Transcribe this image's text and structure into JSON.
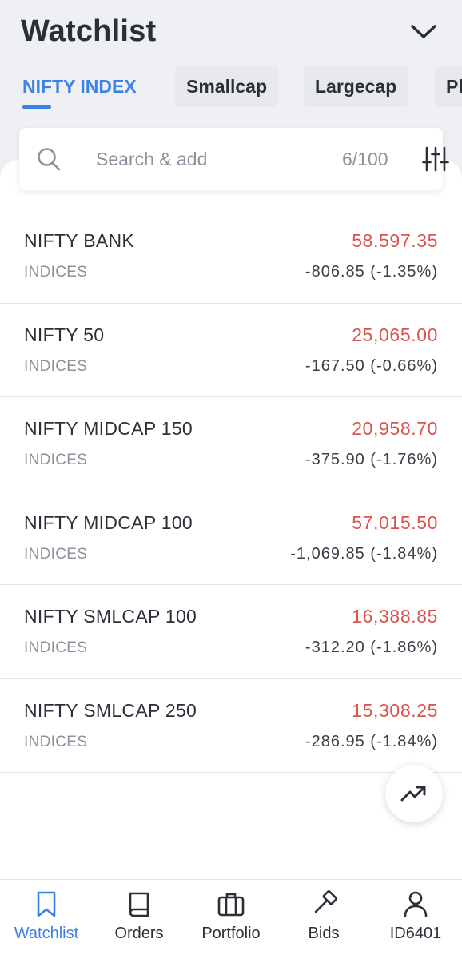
{
  "header": {
    "title": "Watchlist",
    "tabs": [
      {
        "label": "NIFTY INDEX",
        "active": true
      },
      {
        "label": "Smallcap",
        "active": false
      },
      {
        "label": "Largecap",
        "active": false
      },
      {
        "label": "Pl",
        "active": false
      }
    ]
  },
  "search": {
    "placeholder": "Search & add",
    "count": "6/100"
  },
  "rows": [
    {
      "name": "NIFTY BANK",
      "segment": "INDICES",
      "ltp": "58,597.35",
      "change": "-806.85 (-1.35%)"
    },
    {
      "name": "NIFTY 50",
      "segment": "INDICES",
      "ltp": "25,065.00",
      "change": "-167.50 (-0.66%)"
    },
    {
      "name": "NIFTY MIDCAP 150",
      "segment": "INDICES",
      "ltp": "20,958.70",
      "change": "-375.90 (-1.76%)"
    },
    {
      "name": "NIFTY MIDCAP 100",
      "segment": "INDICES",
      "ltp": "57,015.50",
      "change": "-1,069.85 (-1.84%)"
    },
    {
      "name": "NIFTY SMLCAP 100",
      "segment": "INDICES",
      "ltp": "16,388.85",
      "change": "-312.20 (-1.86%)"
    },
    {
      "name": "NIFTY SMLCAP 250",
      "segment": "INDICES",
      "ltp": "15,308.25",
      "change": "-286.95 (-1.84%)"
    }
  ],
  "bottom_nav": [
    {
      "label": "Watchlist",
      "icon": "bookmark-icon",
      "active": true
    },
    {
      "label": "Orders",
      "icon": "book-icon",
      "active": false
    },
    {
      "label": "Portfolio",
      "icon": "briefcase-icon",
      "active": false
    },
    {
      "label": "Bids",
      "icon": "gavel-icon",
      "active": false
    },
    {
      "label": "ID6401",
      "icon": "user-icon",
      "active": false
    }
  ],
  "colors": {
    "accent": "#3b82e6",
    "negative": "#d9534f",
    "text": "#2b2f38",
    "muted": "#8c929d",
    "background": "#eef0f3"
  }
}
